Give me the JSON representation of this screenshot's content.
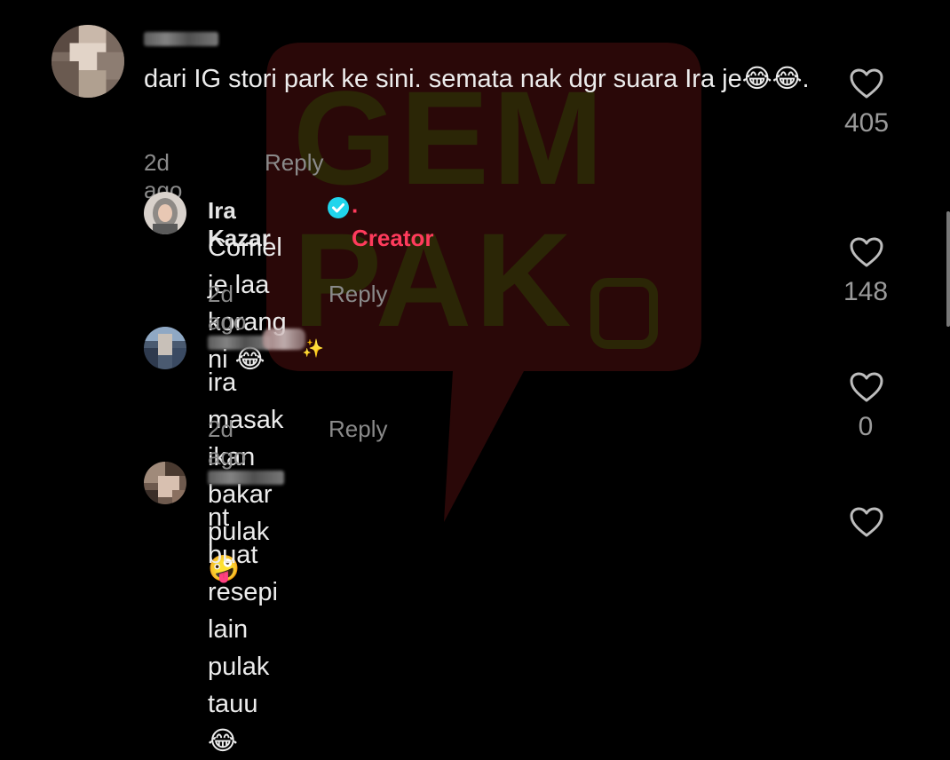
{
  "watermark": {
    "line1": "GEM",
    "line2": "PAK"
  },
  "comments": [
    {
      "text": "dari IG stori park ke sini. semata nak dgr suara Ira je😂😂.",
      "time": "2d ago",
      "reply_label": "Reply",
      "likes": "405"
    },
    {
      "author": "Ira Kazar",
      "creator_badge": "· Creator",
      "text": "Comel je laa korang ni 😂",
      "time": "2d ago",
      "reply_label": "Reply",
      "likes": "148"
    },
    {
      "text": "ira masak ikan bakar pulak 🤪",
      "time": "2d ago",
      "reply_label": "Reply",
      "likes": "0"
    },
    {
      "text": "nt buat resepi lain pulak tauu😂"
    }
  ],
  "colors": {
    "creator": "#ff3b5c",
    "verified": "#20d5ec",
    "muted": "#8a8a8a"
  }
}
